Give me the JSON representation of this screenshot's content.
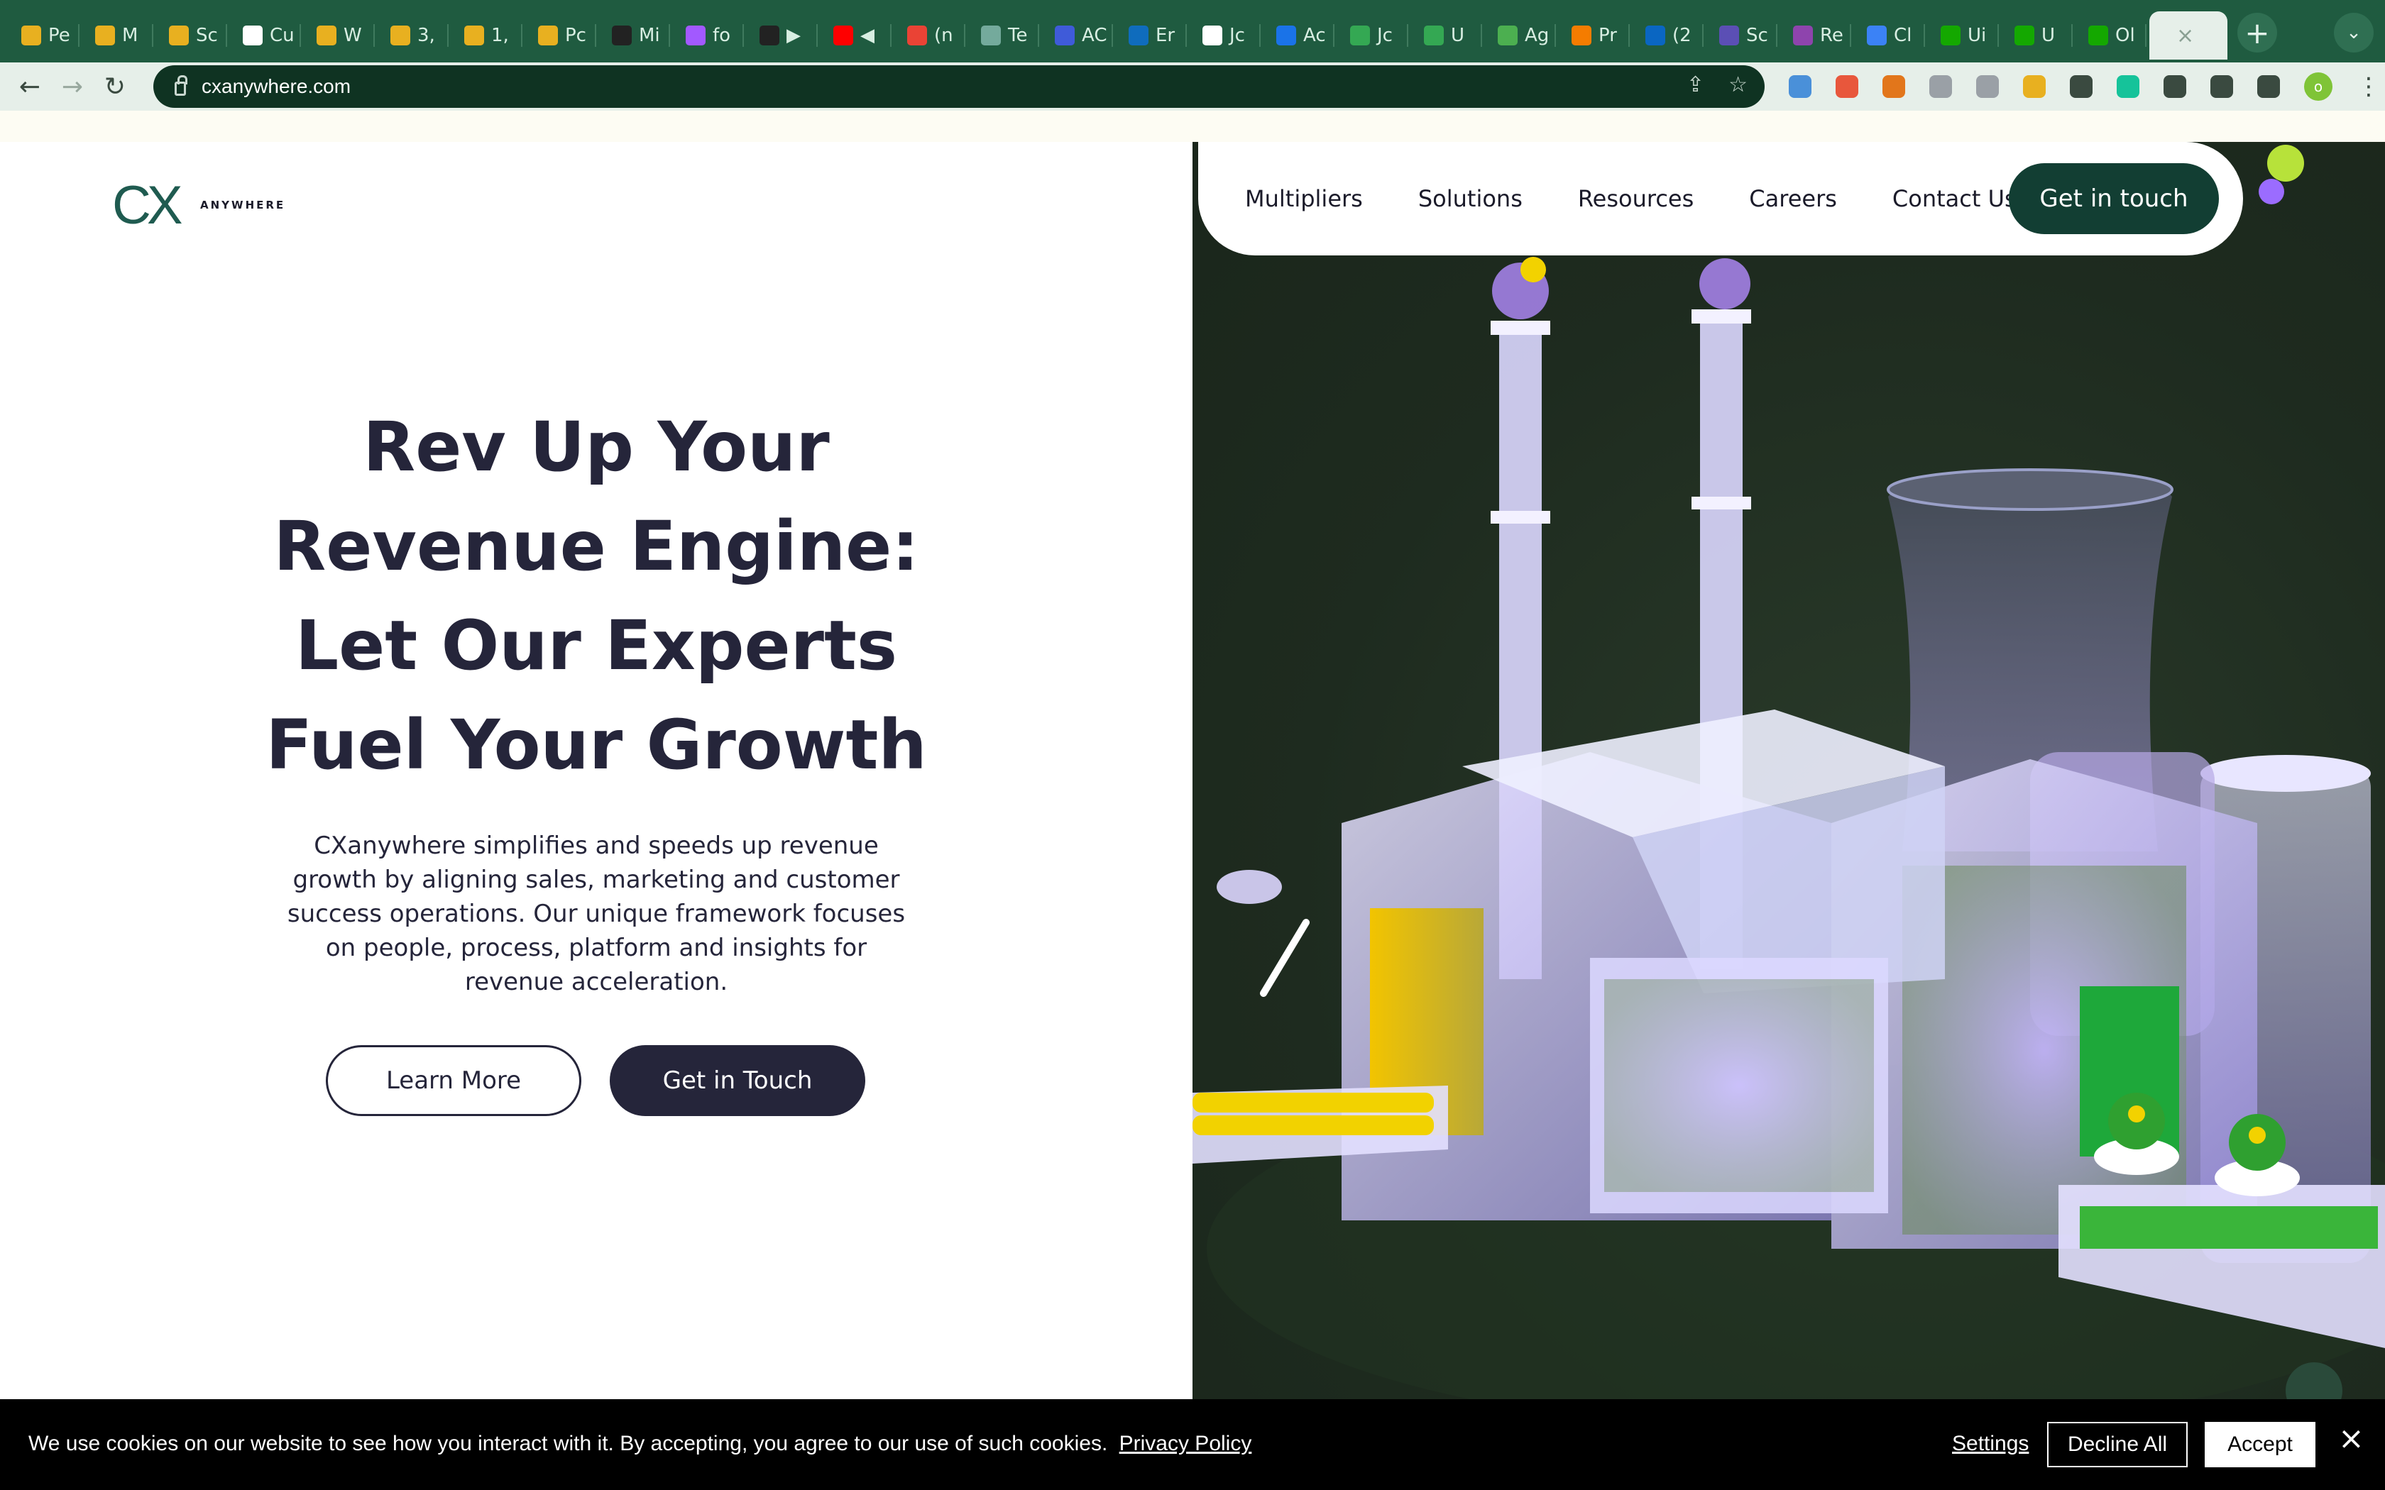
{
  "browser": {
    "tabs": [
      {
        "label": "Pe",
        "icon": "broom-icon",
        "color": "#e8b020"
      },
      {
        "label": "M",
        "icon": "broom-icon",
        "color": "#e8b020"
      },
      {
        "label": "Sc",
        "icon": "broom-icon",
        "color": "#e8b020"
      },
      {
        "label": "Cu",
        "icon": "calendar-icon",
        "color": "#ffffff"
      },
      {
        "label": "W",
        "icon": "broom-icon",
        "color": "#e8b020"
      },
      {
        "label": "3,",
        "icon": "broom-icon",
        "color": "#e8b020"
      },
      {
        "label": "1,",
        "icon": "broom-icon",
        "color": "#e8b020"
      },
      {
        "label": "Pc",
        "icon": "broom-icon",
        "color": "#e8b020"
      },
      {
        "label": "Mi",
        "icon": "miro-icon",
        "color": "#222222"
      },
      {
        "label": "fo",
        "icon": "figma-icon",
        "color": "#a259ff"
      },
      {
        "label": "▶",
        "icon": "miro-icon",
        "color": "#222222"
      },
      {
        "label": "◀",
        "icon": "youtube-icon",
        "color": "#ff0000"
      },
      {
        "label": "(n",
        "icon": "gmail-icon",
        "color": "#ea4335"
      },
      {
        "label": "Te",
        "icon": "openai-icon",
        "color": "#74aa9c"
      },
      {
        "label": "AC",
        "icon": "print-icon",
        "color": "#3f5bd9"
      },
      {
        "label": "Er",
        "icon": "outlook-icon",
        "color": "#0f6cbd"
      },
      {
        "label": "Jc",
        "icon": "info-icon",
        "color": "#ffffff"
      },
      {
        "label": "Ac",
        "icon": "info-square-icon",
        "color": "#1a73e8"
      },
      {
        "label": "Jc",
        "icon": "phone-icon",
        "color": "#34a853"
      },
      {
        "label": "U",
        "icon": "square-icon",
        "color": "#34a853"
      },
      {
        "label": "Ag",
        "icon": "loop-icon",
        "color": "#4caf50"
      },
      {
        "label": "Pr",
        "icon": "box-icon",
        "color": "#f57c00"
      },
      {
        "label": "(2",
        "icon": "linkedin-icon",
        "color": "#0a66c2"
      },
      {
        "label": "Sc",
        "icon": "a-icon",
        "color": "#5b4fb5"
      },
      {
        "label": "Re",
        "icon": "react-icon",
        "color": "#8e44ad"
      },
      {
        "label": "Cl",
        "icon": "c-icon",
        "color": "#3b82f6"
      },
      {
        "label": "Ui",
        "icon": "upwork-icon",
        "color": "#14a800"
      },
      {
        "label": "U",
        "icon": "upwork-icon",
        "color": "#14a800"
      },
      {
        "label": "Ol",
        "icon": "upwork-icon",
        "color": "#14a800"
      }
    ],
    "active_tab_close": "×",
    "new_tab": "+",
    "url": "cxanywhere.com",
    "extensions": [
      {
        "icon": "edge-icon",
        "color": "#4a90d9"
      },
      {
        "icon": "x-circle-icon",
        "color": "#e8573c"
      },
      {
        "icon": "metamask-icon",
        "color": "#e2761b"
      },
      {
        "icon": "v-icon",
        "color": "#9aa0a6"
      },
      {
        "icon": "target-icon",
        "color": "#9aa0a6"
      },
      {
        "icon": "broom-icon",
        "color": "#e8b020"
      },
      {
        "icon": "image-icon",
        "color": "#3a4a40"
      },
      {
        "icon": "grammarly-icon",
        "color": "#15c39a"
      },
      {
        "icon": "puzzle-icon",
        "color": "#3a4a40"
      },
      {
        "icon": "playlist-icon",
        "color": "#3a4a40"
      },
      {
        "icon": "sidepanel-icon",
        "color": "#3a4a40"
      }
    ],
    "profile_initial": "o"
  },
  "site": {
    "logo_mark": "CX",
    "logo_word": "ANYWHERE",
    "nav": [
      "Multipliers",
      "Solutions",
      "Resources",
      "Careers",
      "Contact Us"
    ],
    "nav_cta": "Get in touch",
    "hero_title": "Rev Up Your Revenue Engine: Let Our Experts Fuel Your Growth",
    "hero_text": "CXanywhere simplifies and speeds up revenue growth by aligning sales, marketing and customer success operations. Our unique framework focuses on people, process, platform and insights for revenue acceleration.",
    "learn_more": "Learn More",
    "get_in_touch": "Get in Touch"
  },
  "cookie": {
    "text": "We use cookies on our website to see how you interact with it. By accepting, you agree to our use of such cookies.",
    "link": "Privacy Policy",
    "settings": "Settings",
    "decline": "Decline All",
    "accept": "Accept",
    "close": "×"
  },
  "colors": {
    "chrome_green": "#1f5b40",
    "brand_dark": "#25253a",
    "nav_cta": "#123e33"
  }
}
